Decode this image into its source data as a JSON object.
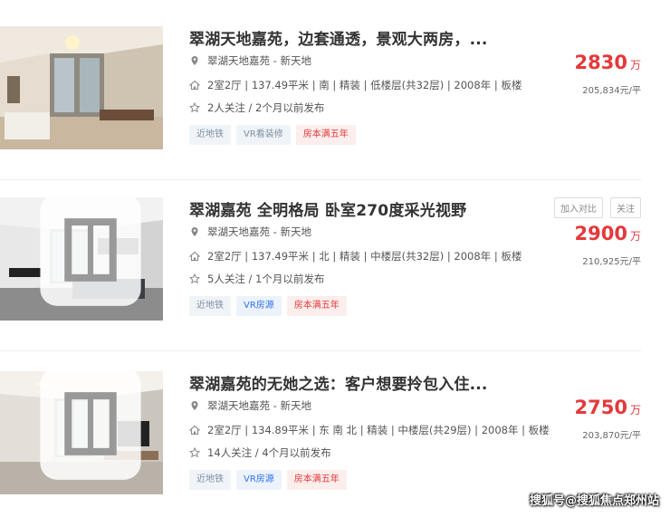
{
  "listings": [
    {
      "title": "翠湖天地嘉苑，边套通透，景观大两房，...",
      "location": "翠湖天地嘉苑 - 新天地",
      "spec": "2室2厅 | 137.49平米 | 南 | 精装 | 低楼层(共32层) | 2008年 | 板楼",
      "follow": "2人关注 / 2个月以前发布",
      "tags": [
        {
          "label": "近地铁",
          "style": "gray"
        },
        {
          "label": "VR看装修",
          "style": "gray"
        },
        {
          "label": "房本满五年",
          "style": "red"
        }
      ],
      "price": "2830",
      "price_unit": "万",
      "unit_price": "205,834元/平",
      "has_vr": false
    },
    {
      "title": "翠湖嘉苑 全明格局 卧室270度采光视野",
      "location": "翠湖天地嘉苑 - 新天地",
      "spec": "2室2厅 | 137.49平米 | 北 | 精装 | 中楼层(共32层) | 2008年 | 板楼",
      "follow": "5人关注 / 1个月以前发布",
      "tags": [
        {
          "label": "近地铁",
          "style": "gray"
        },
        {
          "label": "VR房源",
          "style": "blue"
        },
        {
          "label": "房本满五年",
          "style": "red"
        }
      ],
      "price": "2900",
      "price_unit": "万",
      "unit_price": "210,925元/平",
      "has_vr": true,
      "compare_label": "加入对比",
      "follow_label": "关注"
    },
    {
      "title": "翠湖嘉苑的无她之选：客户想要拎包入住...",
      "location": "翠湖天地嘉苑 - 新天地",
      "spec": "2室2厅 | 134.89平米 | 东 南 北 | 精装 | 中楼层(共29层) | 2008年 | 板楼",
      "follow": "14人关注 / 4个月以前发布",
      "tags": [
        {
          "label": "近地铁",
          "style": "gray"
        },
        {
          "label": "VR房源",
          "style": "blue"
        },
        {
          "label": "房本满五年",
          "style": "red"
        }
      ],
      "price": "2750",
      "price_unit": "万",
      "unit_price": "203,870元/平",
      "has_vr": true
    }
  ],
  "watermark": "搜狐号@搜狐焦点郑州站",
  "colors": {
    "price": "#e4393c",
    "tag_blue": "#3072f6",
    "tag_gray": "#7f8fa4"
  }
}
